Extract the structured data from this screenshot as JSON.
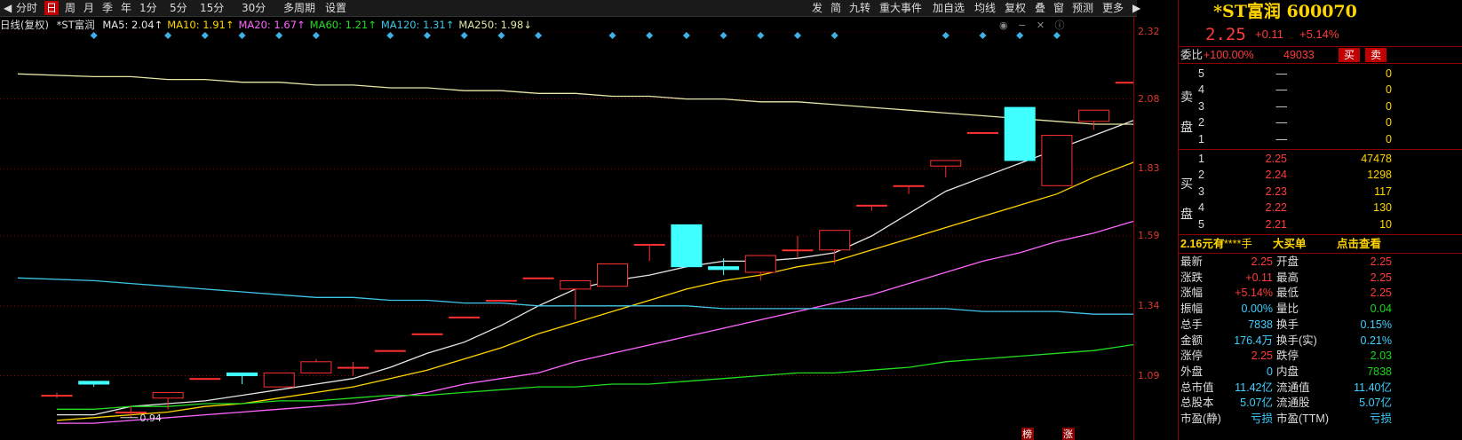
{
  "toolbar": {
    "left": [
      "分时",
      "日",
      "周",
      "月",
      "季",
      "年",
      "1分",
      "5分",
      "15分",
      "30分",
      "多周期",
      "设置"
    ],
    "active": "日",
    "right": [
      "发",
      "简",
      "九转",
      "重大事件",
      "加自选",
      "均线",
      "复权",
      "叠",
      "窗",
      "预测",
      "更多"
    ]
  },
  "ma_bar": {
    "prefix": "日线(复权)",
    "stock": "*ST富润",
    "ma": [
      {
        "label": "MA5: 2.04↑",
        "color": "#e6e6e6"
      },
      {
        "label": "MA10: 1.91↑",
        "color": "#ffd400"
      },
      {
        "label": "MA20: 1.67↑",
        "color": "#ff66ff"
      },
      {
        "label": "MA60: 1.21↑",
        "color": "#22dd22"
      },
      {
        "label": "MA120: 1.31↑",
        "color": "#3fc6e6"
      },
      {
        "label": "MA250: 1.98↓",
        "color": "#e6e6a8"
      }
    ]
  },
  "chart_data": {
    "type": "candlestick",
    "y_ticks": [
      "2.32",
      "2.08",
      "1.83",
      "1.59",
      "1.34",
      "1.09"
    ],
    "y_range": [
      0.86,
      2.32
    ],
    "candles": [
      {
        "o": 1.02,
        "c": 1.02,
        "h": 1.03,
        "l": 1.01
      },
      {
        "o": 1.07,
        "c": 1.06,
        "h": 1.07,
        "l": 1.05,
        "mk": "down"
      },
      {
        "o": 0.96,
        "c": 0.96,
        "h": 0.98,
        "l": 0.94
      },
      {
        "o": 1.01,
        "c": 1.03,
        "h": 1.03,
        "l": 0.97,
        "mk": "up"
      },
      {
        "o": 1.08,
        "c": 1.08,
        "h": 1.08,
        "l": 1.08,
        "mk": "up"
      },
      {
        "o": 1.1,
        "c": 1.09,
        "h": 1.1,
        "l": 1.06,
        "mk": "down"
      },
      {
        "o": 1.05,
        "c": 1.1,
        "h": 1.1,
        "l": 1.05,
        "mk": "up"
      },
      {
        "o": 1.1,
        "c": 1.14,
        "h": 1.15,
        "l": 1.1,
        "mk": "up"
      },
      {
        "o": 1.12,
        "c": 1.12,
        "h": 1.14,
        "l": 1.09
      },
      {
        "o": 1.18,
        "c": 1.18,
        "h": 1.18,
        "l": 1.18,
        "mk": "up"
      },
      {
        "o": 1.24,
        "c": 1.24,
        "h": 1.24,
        "l": 1.24,
        "mk": "up"
      },
      {
        "o": 1.3,
        "c": 1.3,
        "h": 1.3,
        "l": 1.3,
        "mk": "up"
      },
      {
        "o": 1.36,
        "c": 1.36,
        "h": 1.36,
        "l": 1.36,
        "mk": "up"
      },
      {
        "o": 1.44,
        "c": 1.44,
        "h": 1.44,
        "l": 1.44,
        "mk": "up"
      },
      {
        "o": 1.4,
        "c": 1.43,
        "h": 1.43,
        "l": 1.29
      },
      {
        "o": 1.41,
        "c": 1.49,
        "h": 1.49,
        "l": 1.41,
        "mk": "up"
      },
      {
        "o": 1.56,
        "c": 1.56,
        "h": 1.56,
        "l": 1.5,
        "mk": "up"
      },
      {
        "o": 1.63,
        "c": 1.48,
        "h": 1.63,
        "l": 1.48,
        "mk": "down"
      },
      {
        "o": 1.48,
        "c": 1.47,
        "h": 1.51,
        "l": 1.45,
        "mk": "down"
      },
      {
        "o": 1.46,
        "c": 1.52,
        "h": 1.52,
        "l": 1.43,
        "mk": "up"
      },
      {
        "o": 1.54,
        "c": 1.54,
        "h": 1.59,
        "l": 1.51,
        "mk": "up"
      },
      {
        "o": 1.54,
        "c": 1.61,
        "h": 1.61,
        "l": 1.49,
        "mk": "up"
      },
      {
        "o": 1.7,
        "c": 1.7,
        "h": 1.7,
        "l": 1.68
      },
      {
        "o": 1.77,
        "c": 1.77,
        "h": 1.77,
        "l": 1.74
      },
      {
        "o": 1.84,
        "c": 1.86,
        "h": 1.86,
        "l": 1.8,
        "mk": "up"
      },
      {
        "o": 1.96,
        "c": 1.96,
        "h": 1.96,
        "l": 1.96,
        "mk": "up"
      },
      {
        "o": 2.05,
        "c": 1.86,
        "h": 2.05,
        "l": 1.86,
        "mk": "down"
      },
      {
        "o": 1.77,
        "c": 1.95,
        "h": 1.95,
        "l": 1.77,
        "mk": "up"
      },
      {
        "o": 2.0,
        "c": 2.04,
        "h": 2.04,
        "l": 1.97
      },
      {
        "o": 2.14,
        "c": 2.14,
        "h": 2.14,
        "l": 2.14
      },
      {
        "o": 2.25,
        "c": 2.25,
        "h": 2.25,
        "l": 2.25
      }
    ],
    "ma": {
      "MA5": [
        0.95,
        0.95,
        0.98,
        0.99,
        1.0,
        1.02,
        1.04,
        1.06,
        1.08,
        1.12,
        1.17,
        1.21,
        1.27,
        1.34,
        1.4,
        1.43,
        1.45,
        1.48,
        1.5,
        1.5,
        1.51,
        1.53,
        1.59,
        1.67,
        1.75,
        1.8,
        1.85,
        1.9,
        1.95,
        2.0,
        2.04
      ],
      "MA10": [
        0.93,
        0.94,
        0.95,
        0.96,
        0.98,
        0.99,
        1.01,
        1.03,
        1.05,
        1.08,
        1.11,
        1.15,
        1.19,
        1.24,
        1.28,
        1.32,
        1.36,
        1.4,
        1.43,
        1.45,
        1.48,
        1.5,
        1.54,
        1.58,
        1.62,
        1.66,
        1.7,
        1.74,
        1.8,
        1.85,
        1.91
      ],
      "MA20": [
        0.92,
        0.92,
        0.93,
        0.94,
        0.95,
        0.96,
        0.97,
        0.98,
        0.99,
        1.01,
        1.03,
        1.06,
        1.08,
        1.1,
        1.14,
        1.17,
        1.2,
        1.23,
        1.26,
        1.29,
        1.32,
        1.35,
        1.38,
        1.42,
        1.46,
        1.5,
        1.53,
        1.57,
        1.6,
        1.64,
        1.67
      ],
      "MA60": [
        0.97,
        0.97,
        0.98,
        0.98,
        0.99,
        0.99,
        1.0,
        1.0,
        1.01,
        1.02,
        1.02,
        1.03,
        1.04,
        1.05,
        1.05,
        1.06,
        1.06,
        1.07,
        1.08,
        1.09,
        1.1,
        1.1,
        1.11,
        1.12,
        1.14,
        1.15,
        1.16,
        1.17,
        1.18,
        1.2,
        1.21
      ],
      "MA120": [
        1.44,
        1.43,
        1.42,
        1.41,
        1.4,
        1.39,
        1.38,
        1.37,
        1.37,
        1.36,
        1.36,
        1.35,
        1.35,
        1.34,
        1.34,
        1.34,
        1.34,
        1.34,
        1.33,
        1.33,
        1.33,
        1.33,
        1.33,
        1.33,
        1.33,
        1.32,
        1.32,
        1.32,
        1.31,
        1.31,
        1.31
      ],
      "MA250": [
        2.17,
        2.16,
        2.16,
        2.15,
        2.15,
        2.14,
        2.14,
        2.13,
        2.13,
        2.12,
        2.12,
        2.11,
        2.11,
        2.1,
        2.1,
        2.09,
        2.09,
        2.08,
        2.08,
        2.07,
        2.07,
        2.06,
        2.05,
        2.04,
        2.03,
        2.02,
        2.01,
        2.0,
        1.99,
        1.99,
        1.98
      ]
    },
    "annotations": {
      "high": "2.25",
      "low": "0.94"
    },
    "badges": [
      "榜",
      "涨"
    ]
  },
  "panel": {
    "title": "*ST富润 600070",
    "price": "2.25",
    "change": "+0.11",
    "pct": "+5.14%",
    "weibi_label": "委比",
    "weibi": "+100.00%",
    "weicha": "49033",
    "buy_btn": "买",
    "sell_btn": "卖",
    "sell_side": "卖盘",
    "buy_side": "买盘",
    "asks": [
      {
        "lvl": "5",
        "price": "—",
        "vol": "0"
      },
      {
        "lvl": "4",
        "price": "—",
        "vol": "0"
      },
      {
        "lvl": "3",
        "price": "—",
        "vol": "0"
      },
      {
        "lvl": "2",
        "price": "—",
        "vol": "0"
      },
      {
        "lvl": "1",
        "price": "—",
        "vol": "0"
      }
    ],
    "bids": [
      {
        "lvl": "1",
        "price": "2.25",
        "vol": "47478"
      },
      {
        "lvl": "2",
        "price": "2.24",
        "vol": "1298"
      },
      {
        "lvl": "3",
        "price": "2.23",
        "vol": "117"
      },
      {
        "lvl": "4",
        "price": "2.22",
        "vol": "130"
      },
      {
        "lvl": "5",
        "price": "2.21",
        "vol": "10"
      }
    ],
    "bigorder": {
      "a": "2.16元有",
      "b": "*****手",
      "c": "大买单",
      "d": "点击查看"
    },
    "stats": [
      [
        "最新",
        "2.25",
        "开盘",
        "2.25"
      ],
      [
        "涨跌",
        "+0.11",
        "最高",
        "2.25"
      ],
      [
        "涨幅",
        "+5.14%",
        "最低",
        "2.25"
      ],
      [
        "振幅",
        "0.00%",
        "量比",
        "0.04"
      ],
      [
        "总手",
        "7838",
        "换手",
        "0.15%"
      ],
      [
        "金额",
        "176.4万",
        "换手(实)",
        "0.21%"
      ],
      [
        "涨停",
        "2.25",
        "跌停",
        "2.03"
      ],
      [
        "外盘",
        "0",
        "内盘",
        "7838"
      ],
      [
        "总市值",
        "11.42亿",
        "流通值",
        "11.40亿"
      ],
      [
        "总股本",
        "5.07亿",
        "流通股",
        "5.07亿"
      ],
      [
        "市盈(静)",
        "亏损",
        "市盈(TTM)",
        "亏损"
      ]
    ]
  }
}
